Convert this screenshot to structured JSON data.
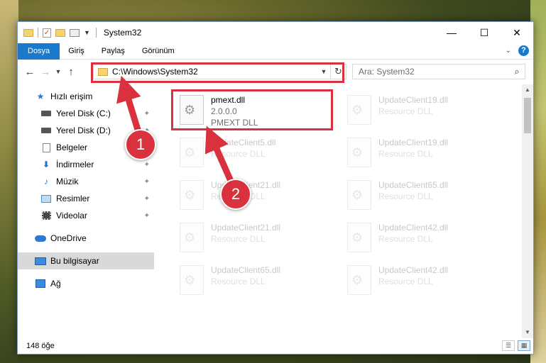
{
  "titlebar": {
    "title": "System32",
    "minimize": "—",
    "maximize": "☐",
    "close": "✕"
  },
  "ribbon": {
    "tabs": [
      "Dosya",
      "Giriş",
      "Paylaş",
      "Görünüm"
    ]
  },
  "address": {
    "path": "C:\\Windows\\System32",
    "search_placeholder": "Ara: System32"
  },
  "nav": {
    "quick_access": "Hızlı erişim",
    "items": [
      {
        "label": "Yerel Disk (C:)",
        "pinned": true
      },
      {
        "label": "Yerel Disk (D:)",
        "pinned": true
      },
      {
        "label": "Belgeler",
        "pinned": false
      },
      {
        "label": "İndirmeler",
        "pinned": true
      },
      {
        "label": "Müzik",
        "pinned": true
      },
      {
        "label": "Resimler",
        "pinned": true
      },
      {
        "label": "Videolar",
        "pinned": true
      }
    ],
    "onedrive": "OneDrive",
    "this_pc": "Bu bilgisayar",
    "network": "Ağ"
  },
  "files": {
    "highlighted": {
      "name": "pmext.dll",
      "version": "2.0.0.0",
      "description": "PMEXT DLL"
    },
    "faded": [
      {
        "name": "UpdateClient19.dll",
        "description": "Resource DLL"
      },
      {
        "name": "UpdateClient5.dll",
        "description": "Resource DLL"
      },
      {
        "name": "UpdateClient19.dll",
        "description": "Resource DLL"
      },
      {
        "name": "UpdateClient21.dll",
        "description": "Resource DLL"
      },
      {
        "name": "UpdateClient65.dll",
        "description": "Resource DLL"
      },
      {
        "name": "UpdateClient21.dll",
        "description": "Resource DLL"
      },
      {
        "name": "UpdateClient42.dll",
        "description": "Resource DLL"
      },
      {
        "name": "UpdateClient65.dll",
        "description": "Resource DLL"
      },
      {
        "name": "UpdateClient42.dll",
        "description": "Resource DLL"
      }
    ]
  },
  "status": {
    "count": "148 öğe"
  },
  "annotations": {
    "step1": "1",
    "step2": "2",
    "color": "#d9323e"
  }
}
